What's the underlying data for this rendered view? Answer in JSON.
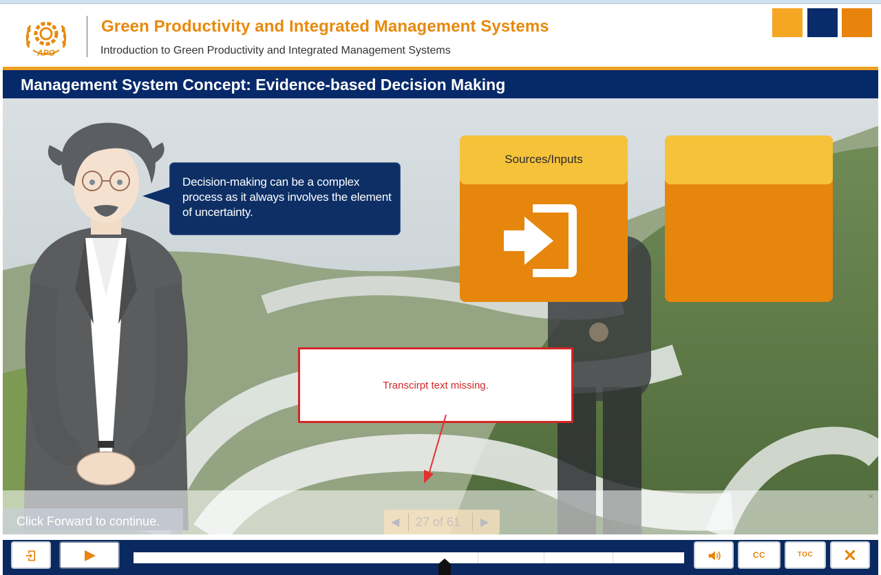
{
  "header": {
    "course_title": "Green Productivity and Integrated Management Systems",
    "course_subtitle": "Introduction to Green Productivity and Integrated Management Systems",
    "expand_glyph": "»",
    "logo_text": "APO"
  },
  "slide": {
    "title": "Management System Concept: Evidence-based Decision Making",
    "speech_bubble": "Decision-making can be a complex process as it always involves the element of uncertainty.",
    "cards": [
      {
        "label": "Sources/Inputs",
        "icon": "sign-in-icon"
      },
      {
        "label": "",
        "icon": ""
      }
    ],
    "annotation": "Transcirpt text missing.",
    "prompt": "Click Forward to continue.",
    "pager": {
      "text": "27 of 61",
      "current": 27,
      "total": 61
    },
    "close_glyph": "×"
  },
  "controls": {
    "cc_label": "CC",
    "toc_label": "TOC",
    "progress_fraction": 0.565
  },
  "colors": {
    "brand_orange": "#e8890c",
    "brand_navy": "#06296a",
    "card_head_yellow": "#f5c23a",
    "annotation_red": "#d42626"
  }
}
